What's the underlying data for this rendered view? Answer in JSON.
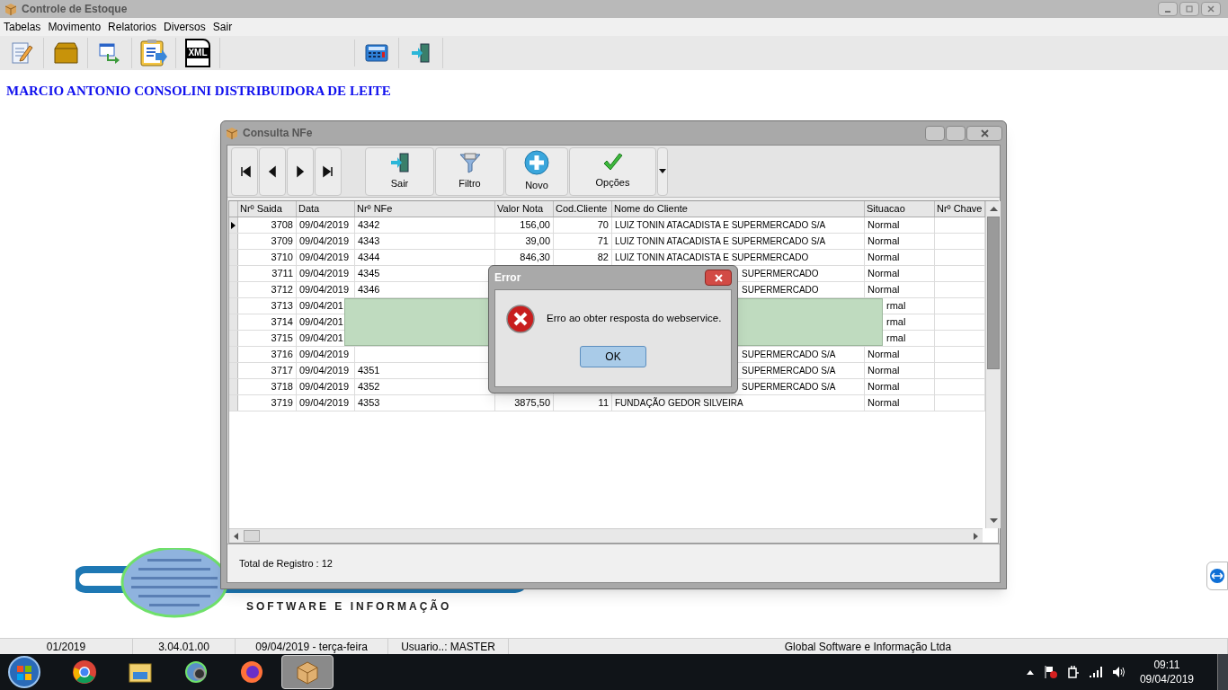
{
  "window": {
    "title": "Controle de Estoque"
  },
  "menu": [
    {
      "label": "Tabelas"
    },
    {
      "label": "Movimento"
    },
    {
      "label": "Relatorios"
    },
    {
      "label": "Diversos"
    },
    {
      "label": "Sair"
    }
  ],
  "toolbar": [
    {
      "kind": "notepad"
    },
    {
      "kind": "box"
    },
    {
      "kind": "window-arrow"
    },
    {
      "kind": "clipboard"
    },
    {
      "kind": "xml",
      "label": "XML"
    },
    {
      "kind": "separator"
    },
    {
      "kind": "calculator"
    },
    {
      "kind": "exit"
    }
  ],
  "company": "MARCIO ANTONIO CONSOLINI DISTRIBUIDORA DE LEITE",
  "logo": {
    "tagline": "SOFTWARE E INFORMAÇÃO"
  },
  "consulta": {
    "title": "Consulta NFe",
    "actions": [
      {
        "kind": "exit",
        "label": "Sair"
      },
      {
        "kind": "filter",
        "label": "Filtro"
      },
      {
        "kind": "add",
        "label": "Novo"
      },
      {
        "kind": "check",
        "label": "Opções"
      }
    ],
    "table": {
      "columns": [
        "Nrº Saida",
        "Data",
        "Nrº NFe",
        "Valor Nota",
        "Cod.Cliente",
        "Nome do Cliente",
        "Situacao",
        "Nrº Chave"
      ],
      "rows": [
        {
          "selected": true,
          "saida": "3708",
          "data": "09/04/2019",
          "nfe": "4342",
          "valor": "156,00",
          "cod": "70",
          "nome": "LUIZ TONIN ATACADISTA E SUPERMERCADO S/A",
          "situacao": "Normal"
        },
        {
          "selected": false,
          "saida": "3709",
          "data": "09/04/2019",
          "nfe": "4343",
          "valor": "39,00",
          "cod": "71",
          "nome": "LUIZ TONIN ATACADISTA E SUPERMERCADO S/A",
          "situacao": "Normal"
        },
        {
          "selected": false,
          "saida": "3710",
          "data": "09/04/2019",
          "nfe": "4344",
          "valor": "846,30",
          "cod": "82",
          "nome": "LUIZ TONIN ATACADISTA E SUPERMERCADO",
          "situacao": "Normal"
        },
        {
          "selected": false,
          "saida": "3711",
          "data": "09/04/2019",
          "nfe": "4345",
          "nome": "SUPERMERCADO",
          "situacao": "Normal"
        },
        {
          "selected": false,
          "saida": "3712",
          "data": "09/04/2019",
          "nfe": "4346",
          "nome": "SUPERMERCADO",
          "situacao": "Normal"
        },
        {
          "selected": false,
          "saida": "3713",
          "data": "09/04/201",
          "situacao": "rmal"
        },
        {
          "selected": false,
          "saida": "3714",
          "data": "09/04/201",
          "situacao": "rmal"
        },
        {
          "selected": false,
          "saida": "3715",
          "data": "09/04/201",
          "situacao": "rmal"
        },
        {
          "selected": false,
          "saida": "3716",
          "data": "09/04/2019",
          "nome": "SUPERMERCADO S/A",
          "situacao": "Normal"
        },
        {
          "selected": false,
          "saida": "3717",
          "data": "09/04/2019",
          "nfe": "4351",
          "nome": "SUPERMERCADO S/A",
          "situacao": "Normal"
        },
        {
          "selected": false,
          "saida": "3718",
          "data": "09/04/2019",
          "nfe": "4352",
          "nome": "SUPERMERCADO S/A",
          "situacao": "Normal"
        },
        {
          "selected": false,
          "saida": "3719",
          "data": "09/04/2019",
          "nfe": "4353",
          "valor": "3875,50",
          "cod": "11",
          "nome": "FUNDAÇÃO  GEDOR SILVEIRA",
          "situacao": "Normal"
        }
      ]
    },
    "footer": "Total de Registro : 12"
  },
  "error_dialog": {
    "title": "Error",
    "message": "Erro ao obter resposta do webservice.",
    "button": "OK"
  },
  "status_bar": [
    "01/2019",
    "3.04.01.00",
    "09/04/2019 - terça-feira",
    "Usuario..: MASTER",
    "Global Software e Informação Ltda"
  ],
  "taskbar": {
    "apps": [
      {
        "kind": "chrome",
        "selected": false
      },
      {
        "kind": "folder",
        "selected": false
      },
      {
        "kind": "gear",
        "selected": false
      },
      {
        "kind": "firefox",
        "selected": false
      },
      {
        "kind": "box",
        "selected": true
      }
    ],
    "time": "09:11",
    "date": "09/04/2019"
  }
}
